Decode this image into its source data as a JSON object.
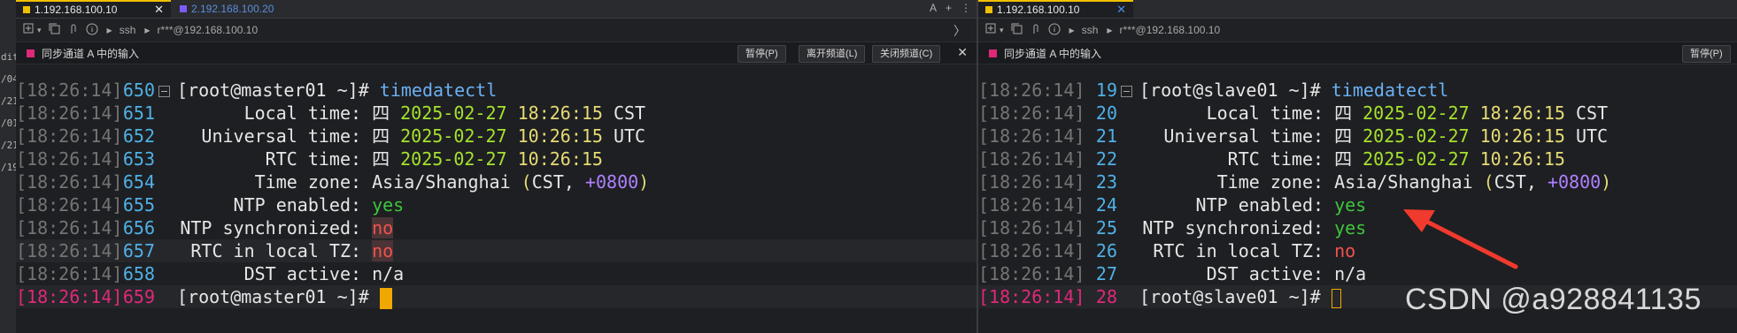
{
  "left_strip": {
    "fragments": [
      "dit",
      "/04",
      "/21",
      "/01",
      "/21",
      "/19"
    ]
  },
  "left_pane": {
    "tabs": [
      {
        "label": "1.192.168.100.10",
        "active": true,
        "color": "#f0c000"
      },
      {
        "label": "2.192.168.100.20",
        "active": false,
        "color": "#7b5cff"
      }
    ],
    "tab_close": "✕",
    "tabbar_icons": [
      "A",
      "+",
      "⋮"
    ],
    "toolbar": {
      "ssh_label": "ssh",
      "host": "r***@192.168.100.10"
    },
    "syncbar": {
      "label": "同步通道 A 中的输入",
      "pause_button": "暂停(P)",
      "leave_button": "离开频道(L)",
      "close_channel_button": "关闭频道(C)",
      "close_icon": "✕"
    },
    "lines": [
      {
        "ts": "[18:26:14]",
        "ln": "650",
        "type": "prompt",
        "prompt": "[root@master01 ~]",
        "hash": "#",
        "cmd": "timedatectl",
        "fold": true
      },
      {
        "ts": "[18:26:14]",
        "ln": "651",
        "type": "kv",
        "key": "Local time",
        "sep": ": ",
        "w": "四 ",
        "date": "2025-02-27",
        "time": "18:26:15",
        "suffix": " CST"
      },
      {
        "ts": "[18:26:14]",
        "ln": "652",
        "type": "kv",
        "key": "Universal time",
        "sep": ": ",
        "w": "四 ",
        "date": "2025-02-27",
        "time": "10:26:15",
        "suffix": " UTC"
      },
      {
        "ts": "[18:26:14]",
        "ln": "653",
        "type": "kv",
        "key": "RTC time",
        "sep": ": ",
        "w": "四 ",
        "date": "2025-02-27",
        "time": "10:26:15",
        "suffix": ""
      },
      {
        "ts": "[18:26:14]",
        "ln": "654",
        "type": "tz",
        "key": "Time zone",
        "sep": ": ",
        "tz": "Asia/Shanghai",
        "open": " (",
        "tzabbr": "CST",
        "comma": ", ",
        "offset": "+0800",
        "close": ")"
      },
      {
        "ts": "[18:26:14]",
        "ln": "655",
        "type": "flag",
        "key": "NTP enabled",
        "sep": ": ",
        "value": "yes",
        "status": "yes"
      },
      {
        "ts": "[18:26:14]",
        "ln": "656",
        "type": "flag",
        "key": "NTP synchronized",
        "sep": ": ",
        "value": "no",
        "status": "no-bg"
      },
      {
        "ts": "[18:26:14]",
        "ln": "657",
        "type": "flag",
        "key": "RTC in local TZ",
        "sep": ": ",
        "value": "no",
        "status": "no-bg",
        "highlight": true
      },
      {
        "ts": "[18:26:14]",
        "ln": "658",
        "type": "flag",
        "key": "DST active",
        "sep": ": ",
        "value": "n/a",
        "status": "plain"
      },
      {
        "ts": "[18:26:14]",
        "ln": "659",
        "type": "prompt",
        "prompt": "[root@master01 ~]",
        "hash": "#",
        "cmd": "",
        "current": true,
        "cursor": "block"
      }
    ]
  },
  "right_pane": {
    "tabs": [
      {
        "label": "1.192.168.100.10",
        "active": true,
        "color": "#f0c000"
      }
    ],
    "tab_close": "✕",
    "toolbar": {
      "ssh_label": "ssh",
      "host": "r***@192.168.100.10"
    },
    "syncbar": {
      "label": "同步通道 A 中的输入",
      "pause_button": "暂停(P)"
    },
    "lines": [
      {
        "ts": "[18:26:14]",
        "ln": "19",
        "type": "prompt",
        "prompt": "[root@slave01 ~]",
        "hash": "#",
        "cmd": "timedatectl",
        "fold": true
      },
      {
        "ts": "[18:26:14]",
        "ln": "20",
        "type": "kv",
        "key": "Local time",
        "sep": ": ",
        "w": "四 ",
        "date": "2025-02-27",
        "time": "18:26:15",
        "suffix": " CST"
      },
      {
        "ts": "[18:26:14]",
        "ln": "21",
        "type": "kv",
        "key": "Universal time",
        "sep": ": ",
        "w": "四 ",
        "date": "2025-02-27",
        "time": "10:26:15",
        "suffix": " UTC"
      },
      {
        "ts": "[18:26:14]",
        "ln": "22",
        "type": "kv",
        "key": "RTC time",
        "sep": ": ",
        "w": "四 ",
        "date": "2025-02-27",
        "time": "10:26:15",
        "suffix": ""
      },
      {
        "ts": "[18:26:14]",
        "ln": "23",
        "type": "tz",
        "key": "Time zone",
        "sep": ": ",
        "tz": "Asia/Shanghai",
        "open": " (",
        "tzabbr": "CST",
        "comma": ", ",
        "offset": "+0800",
        "close": ")"
      },
      {
        "ts": "[18:26:14]",
        "ln": "24",
        "type": "flag",
        "key": "NTP enabled",
        "sep": ": ",
        "value": "yes",
        "status": "yes"
      },
      {
        "ts": "[18:26:14]",
        "ln": "25",
        "type": "flag",
        "key": "NTP synchronized",
        "sep": ": ",
        "value": "yes",
        "status": "yes"
      },
      {
        "ts": "[18:26:14]",
        "ln": "26",
        "type": "flag",
        "key": "RTC in local TZ",
        "sep": ": ",
        "value": "no",
        "status": "no"
      },
      {
        "ts": "[18:26:14]",
        "ln": "27",
        "type": "flag",
        "key": "DST active",
        "sep": ": ",
        "value": "n/a",
        "status": "plain"
      },
      {
        "ts": "[18:26:14]",
        "ln": "28",
        "type": "prompt",
        "prompt": "[root@slave01 ~]",
        "hash": "#",
        "cmd": "",
        "current": true,
        "cursor": "hollow"
      }
    ]
  },
  "annotation": {
    "color": "#f03a2e"
  },
  "watermark": "CSDN @a928841135",
  "colors": {
    "background": "#1e1f22",
    "line_number": "#4fb1e6",
    "timestamp": "#747474",
    "current_line_pink": "#e0287a",
    "date_green": "#a6e22e",
    "time_yellow": "#e6db74",
    "offset_purple": "#ae81ff",
    "yes_green": "#3ec43e",
    "no_red": "#f0524f",
    "cursor_orange": "#f0a800"
  }
}
